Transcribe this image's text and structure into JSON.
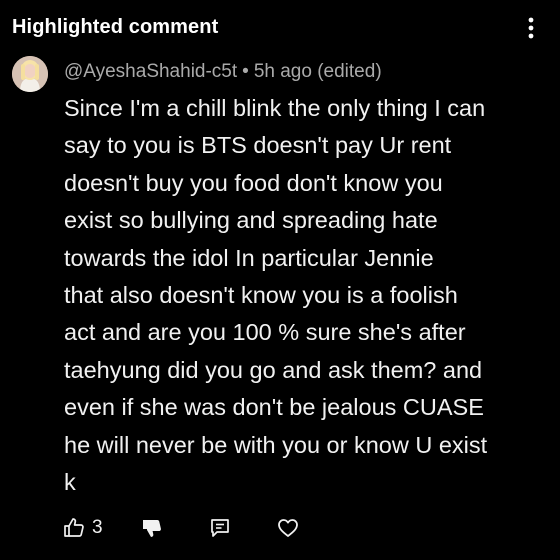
{
  "header": {
    "title": "Highlighted comment",
    "menu_icon": "more-vertical-icon"
  },
  "comment": {
    "author": "@AyeshaShahid-c5t",
    "separator": "•",
    "time": "5h ago",
    "edited": "(edited)",
    "text": "Since I'm a chill blink the only thing I can\nsay to you is BTS doesn't pay Ur rent\ndoesn't buy you food don't know you\nexist so bullying and spreading hate\ntowards the idol In particular Jennie\nthat also doesn't know you is a foolish\nact and are you 100 % sure she's after\ntaehyung did you go and ask them? and\neven if she was don't be jealous CUASE\nhe will never be with you or know U exist\nk"
  },
  "actions": {
    "like_count": "3",
    "like_icon": "thumbs-up-icon",
    "dislike_icon": "thumbs-down-icon",
    "reply_icon": "reply-comment-icon",
    "heart_icon": "heart-icon"
  },
  "colors": {
    "background": "#000000",
    "primary_text": "#f1f1f1",
    "secondary_text": "#aaaaaa"
  }
}
